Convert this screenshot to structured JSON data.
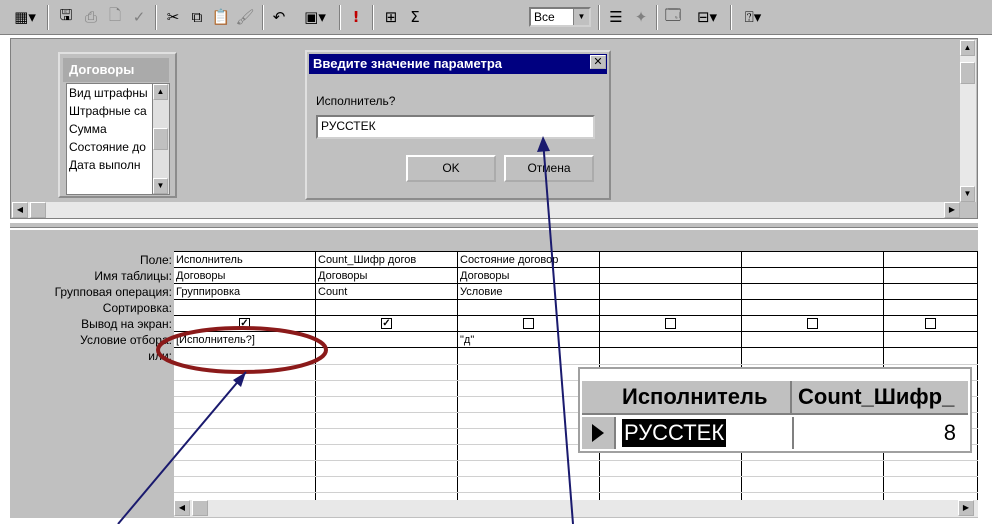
{
  "toolbar": {
    "buttons": [
      "view-icon",
      "save-icon",
      "print-icon",
      "preview-icon",
      "spell-icon",
      "cut-icon",
      "copy-icon",
      "paste-icon",
      "format-painter-icon",
      "undo-icon",
      "query-type-icon",
      "run-icon",
      "show-table-icon",
      "totals-icon",
      "properties-icon",
      "build-icon",
      "database-window-icon",
      "new-object-icon",
      "help-icon"
    ],
    "top_values": "Все"
  },
  "field_list": {
    "title": "Договоры",
    "items": [
      "Вид штрафны",
      "Штрафные са",
      "Сумма",
      "Состояние до",
      "Дата выполн"
    ]
  },
  "dialog": {
    "title": "Введите значение параметра",
    "prompt": "Исполнитель?",
    "value": "РУССТЕК",
    "ok_label": "OK",
    "cancel_label": "Отмена"
  },
  "qbe": {
    "row_labels": [
      "Поле:",
      "Имя таблицы:",
      "Групповая операция:",
      "Сортировка:",
      "Вывод на экран:",
      "Условие отбора:",
      "или:"
    ],
    "columns": [
      {
        "field": "Исполнитель",
        "table": "Договоры",
        "total": "Группировка",
        "sort": "",
        "show": true,
        "criteria": "[Исполнитель?]"
      },
      {
        "field": "Count_Шифр догов",
        "table": "Договоры",
        "total": "Count",
        "sort": "",
        "show": true,
        "criteria": ""
      },
      {
        "field": "Состояние договор",
        "table": "Договоры",
        "total": "Условие",
        "sort": "",
        "show": false,
        "criteria": "\"д\""
      },
      {
        "field": "",
        "table": "",
        "total": "",
        "sort": "",
        "show": false,
        "criteria": ""
      },
      {
        "field": "",
        "table": "",
        "total": "",
        "sort": "",
        "show": false,
        "criteria": ""
      },
      {
        "field": "",
        "table": "",
        "total": "",
        "sort": "",
        "show": false,
        "criteria": ""
      }
    ]
  },
  "result": {
    "headers": [
      "Исполнитель",
      "Count_Шифр_"
    ],
    "value": "РУССТЕК",
    "count": "8"
  },
  "colors": {
    "highlight_ellipse": "#8b1a1a",
    "arrow": "#1a1a6e",
    "dialog_title": "#000080"
  }
}
